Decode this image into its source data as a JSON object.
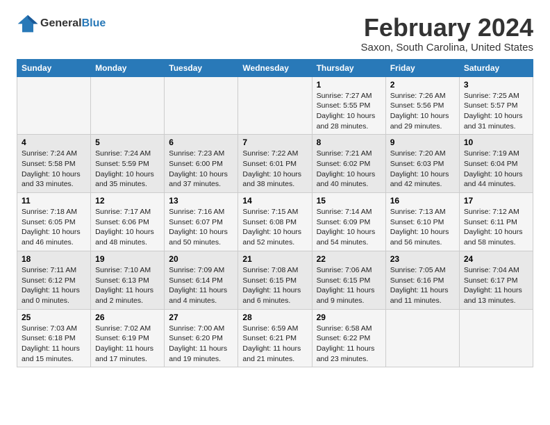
{
  "logo": {
    "line1": "General",
    "line2": "Blue"
  },
  "title": "February 2024",
  "subtitle": "Saxon, South Carolina, United States",
  "days_of_week": [
    "Sunday",
    "Monday",
    "Tuesday",
    "Wednesday",
    "Thursday",
    "Friday",
    "Saturday"
  ],
  "weeks": [
    [
      {
        "day": "",
        "info": ""
      },
      {
        "day": "",
        "info": ""
      },
      {
        "day": "",
        "info": ""
      },
      {
        "day": "",
        "info": ""
      },
      {
        "day": "1",
        "info": "Sunrise: 7:27 AM\nSunset: 5:55 PM\nDaylight: 10 hours\nand 28 minutes."
      },
      {
        "day": "2",
        "info": "Sunrise: 7:26 AM\nSunset: 5:56 PM\nDaylight: 10 hours\nand 29 minutes."
      },
      {
        "day": "3",
        "info": "Sunrise: 7:25 AM\nSunset: 5:57 PM\nDaylight: 10 hours\nand 31 minutes."
      }
    ],
    [
      {
        "day": "4",
        "info": "Sunrise: 7:24 AM\nSunset: 5:58 PM\nDaylight: 10 hours\nand 33 minutes."
      },
      {
        "day": "5",
        "info": "Sunrise: 7:24 AM\nSunset: 5:59 PM\nDaylight: 10 hours\nand 35 minutes."
      },
      {
        "day": "6",
        "info": "Sunrise: 7:23 AM\nSunset: 6:00 PM\nDaylight: 10 hours\nand 37 minutes."
      },
      {
        "day": "7",
        "info": "Sunrise: 7:22 AM\nSunset: 6:01 PM\nDaylight: 10 hours\nand 38 minutes."
      },
      {
        "day": "8",
        "info": "Sunrise: 7:21 AM\nSunset: 6:02 PM\nDaylight: 10 hours\nand 40 minutes."
      },
      {
        "day": "9",
        "info": "Sunrise: 7:20 AM\nSunset: 6:03 PM\nDaylight: 10 hours\nand 42 minutes."
      },
      {
        "day": "10",
        "info": "Sunrise: 7:19 AM\nSunset: 6:04 PM\nDaylight: 10 hours\nand 44 minutes."
      }
    ],
    [
      {
        "day": "11",
        "info": "Sunrise: 7:18 AM\nSunset: 6:05 PM\nDaylight: 10 hours\nand 46 minutes."
      },
      {
        "day": "12",
        "info": "Sunrise: 7:17 AM\nSunset: 6:06 PM\nDaylight: 10 hours\nand 48 minutes."
      },
      {
        "day": "13",
        "info": "Sunrise: 7:16 AM\nSunset: 6:07 PM\nDaylight: 10 hours\nand 50 minutes."
      },
      {
        "day": "14",
        "info": "Sunrise: 7:15 AM\nSunset: 6:08 PM\nDaylight: 10 hours\nand 52 minutes."
      },
      {
        "day": "15",
        "info": "Sunrise: 7:14 AM\nSunset: 6:09 PM\nDaylight: 10 hours\nand 54 minutes."
      },
      {
        "day": "16",
        "info": "Sunrise: 7:13 AM\nSunset: 6:10 PM\nDaylight: 10 hours\nand 56 minutes."
      },
      {
        "day": "17",
        "info": "Sunrise: 7:12 AM\nSunset: 6:11 PM\nDaylight: 10 hours\nand 58 minutes."
      }
    ],
    [
      {
        "day": "18",
        "info": "Sunrise: 7:11 AM\nSunset: 6:12 PM\nDaylight: 11 hours\nand 0 minutes."
      },
      {
        "day": "19",
        "info": "Sunrise: 7:10 AM\nSunset: 6:13 PM\nDaylight: 11 hours\nand 2 minutes."
      },
      {
        "day": "20",
        "info": "Sunrise: 7:09 AM\nSunset: 6:14 PM\nDaylight: 11 hours\nand 4 minutes."
      },
      {
        "day": "21",
        "info": "Sunrise: 7:08 AM\nSunset: 6:15 PM\nDaylight: 11 hours\nand 6 minutes."
      },
      {
        "day": "22",
        "info": "Sunrise: 7:06 AM\nSunset: 6:15 PM\nDaylight: 11 hours\nand 9 minutes."
      },
      {
        "day": "23",
        "info": "Sunrise: 7:05 AM\nSunset: 6:16 PM\nDaylight: 11 hours\nand 11 minutes."
      },
      {
        "day": "24",
        "info": "Sunrise: 7:04 AM\nSunset: 6:17 PM\nDaylight: 11 hours\nand 13 minutes."
      }
    ],
    [
      {
        "day": "25",
        "info": "Sunrise: 7:03 AM\nSunset: 6:18 PM\nDaylight: 11 hours\nand 15 minutes."
      },
      {
        "day": "26",
        "info": "Sunrise: 7:02 AM\nSunset: 6:19 PM\nDaylight: 11 hours\nand 17 minutes."
      },
      {
        "day": "27",
        "info": "Sunrise: 7:00 AM\nSunset: 6:20 PM\nDaylight: 11 hours\nand 19 minutes."
      },
      {
        "day": "28",
        "info": "Sunrise: 6:59 AM\nSunset: 6:21 PM\nDaylight: 11 hours\nand 21 minutes."
      },
      {
        "day": "29",
        "info": "Sunrise: 6:58 AM\nSunset: 6:22 PM\nDaylight: 11 hours\nand 23 minutes."
      },
      {
        "day": "",
        "info": ""
      },
      {
        "day": "",
        "info": ""
      }
    ]
  ]
}
